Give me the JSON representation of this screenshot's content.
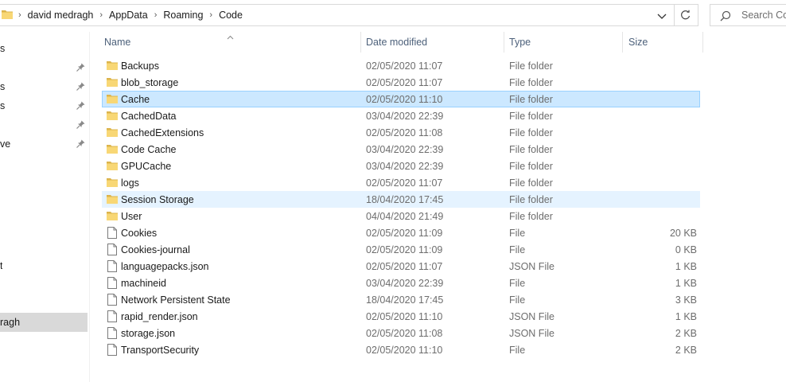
{
  "address": {
    "crumbs": [
      "david medragh",
      "AppData",
      "Roaming",
      "Code"
    ]
  },
  "search": {
    "placeholder": "Search Code"
  },
  "nav": {
    "items": [
      {
        "label": "s",
        "pinned": false,
        "selected": false
      },
      {
        "label": "",
        "pinned": true,
        "selected": false
      },
      {
        "label": "s",
        "pinned": true,
        "selected": false
      },
      {
        "label": "s",
        "pinned": true,
        "selected": false
      },
      {
        "label": "",
        "pinned": true,
        "selected": false
      },
      {
        "label": "ve",
        "pinned": true,
        "selected": false
      },
      {
        "label": "t",
        "pinned": false,
        "selected": false
      },
      {
        "label": "ragh",
        "pinned": false,
        "selected": true
      }
    ]
  },
  "columns": {
    "name": "Name",
    "date": "Date modified",
    "type": "Type",
    "size": "Size"
  },
  "files": [
    {
      "name": "Backups",
      "date": "02/05/2020 11:07",
      "type": "File folder",
      "size": "",
      "kind": "folder",
      "state": ""
    },
    {
      "name": "blob_storage",
      "date": "02/05/2020 11:07",
      "type": "File folder",
      "size": "",
      "kind": "folder",
      "state": ""
    },
    {
      "name": "Cache",
      "date": "02/05/2020 11:10",
      "type": "File folder",
      "size": "",
      "kind": "folder",
      "state": "selected"
    },
    {
      "name": "CachedData",
      "date": "03/04/2020 22:39",
      "type": "File folder",
      "size": "",
      "kind": "folder",
      "state": ""
    },
    {
      "name": "CachedExtensions",
      "date": "02/05/2020 11:08",
      "type": "File folder",
      "size": "",
      "kind": "folder",
      "state": ""
    },
    {
      "name": "Code Cache",
      "date": "03/04/2020 22:39",
      "type": "File folder",
      "size": "",
      "kind": "folder",
      "state": ""
    },
    {
      "name": "GPUCache",
      "date": "03/04/2020 22:39",
      "type": "File folder",
      "size": "",
      "kind": "folder",
      "state": ""
    },
    {
      "name": "logs",
      "date": "02/05/2020 11:07",
      "type": "File folder",
      "size": "",
      "kind": "folder",
      "state": ""
    },
    {
      "name": "Session Storage",
      "date": "18/04/2020 17:45",
      "type": "File folder",
      "size": "",
      "kind": "folder",
      "state": "hover"
    },
    {
      "name": "User",
      "date": "04/04/2020 21:49",
      "type": "File folder",
      "size": "",
      "kind": "folder",
      "state": ""
    },
    {
      "name": "Cookies",
      "date": "02/05/2020 11:09",
      "type": "File",
      "size": "20 KB",
      "kind": "file",
      "state": ""
    },
    {
      "name": "Cookies-journal",
      "date": "02/05/2020 11:09",
      "type": "File",
      "size": "0 KB",
      "kind": "file",
      "state": ""
    },
    {
      "name": "languagepacks.json",
      "date": "02/05/2020 11:07",
      "type": "JSON File",
      "size": "1 KB",
      "kind": "file",
      "state": ""
    },
    {
      "name": "machineid",
      "date": "03/04/2020 22:39",
      "type": "File",
      "size": "1 KB",
      "kind": "file",
      "state": ""
    },
    {
      "name": "Network Persistent State",
      "date": "18/04/2020 17:45",
      "type": "File",
      "size": "3 KB",
      "kind": "file",
      "state": ""
    },
    {
      "name": "rapid_render.json",
      "date": "02/05/2020 11:10",
      "type": "JSON File",
      "size": "1 KB",
      "kind": "file",
      "state": ""
    },
    {
      "name": "storage.json",
      "date": "02/05/2020 11:08",
      "type": "JSON File",
      "size": "2 KB",
      "kind": "file",
      "state": ""
    },
    {
      "name": "TransportSecurity",
      "date": "02/05/2020 11:10",
      "type": "File",
      "size": "2 KB",
      "kind": "file",
      "state": ""
    }
  ],
  "colors": {
    "selected_bg": "#cce8ff",
    "hover_bg": "#e5f3ff",
    "folder": "#f8d775",
    "header_text": "#4c607a"
  }
}
